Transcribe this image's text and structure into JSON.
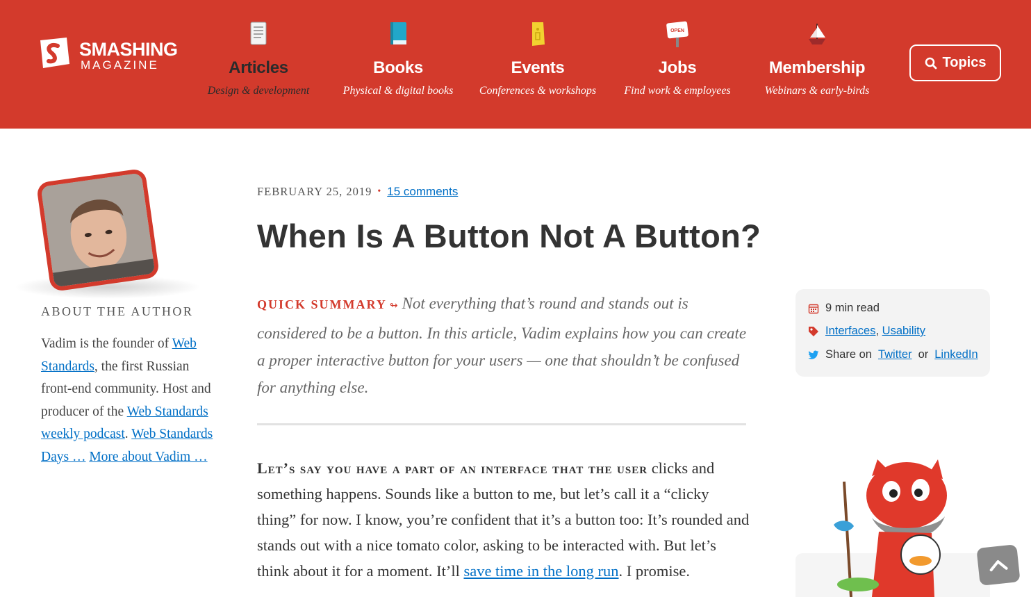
{
  "logo": {
    "title": "SMASHING",
    "subtitle": "MAGAZINE"
  },
  "nav": [
    {
      "title": "Articles",
      "subtitle": "Design & development",
      "icon": "article-icon",
      "active": true
    },
    {
      "title": "Books",
      "subtitle": "Physical & digital books",
      "icon": "book-icon"
    },
    {
      "title": "Events",
      "subtitle": "Conferences & workshops",
      "icon": "ticket-icon"
    },
    {
      "title": "Jobs",
      "subtitle": "Find work & employees",
      "icon": "open-sign-icon",
      "icon_text": "OPEN"
    },
    {
      "title": "Membership",
      "subtitle": "Webinars & early-birds",
      "icon": "ship-icon"
    }
  ],
  "topics": {
    "label": "Topics",
    "icon": "search-icon"
  },
  "author": {
    "about_label": "ABOUT THE AUTHOR",
    "bio_parts": {
      "t1": "Vadim is the founder of ",
      "l1": "Web Standards",
      "t2": ", the first Russian front-end community. Host and producer of the ",
      "l2": "Web Standards weekly podcast",
      "t3": ". ",
      "l3": "Web Standards Days …",
      "t4": " ",
      "l4": "More about Vadim …"
    }
  },
  "article": {
    "date": "FEBRUARY 25, 2019",
    "comments": "15 comments",
    "title": "When Is A Button Not A Button?",
    "summary_label": "QUICK SUMMARY",
    "summary_arrow": "↬",
    "summary": "Not everything that’s round and stands out is considered to be a button. In this article, Vadim explains how you can create a proper interactive button for your users — one that shouldn’t be confused for anything else.",
    "body_lead": "Let’s say you have a part of an interface that the user",
    "body_text": " clicks and something happens. Sounds like a button to me, but let’s call it a “clicky thing” for now. I know, you’re confident that it’s a button too: It’s rounded and stands out with a nice tomato color, asking to be interacted with. But let’s think about it for a moment. It’ll ",
    "body_link": "save time in the long run",
    "body_tail": ". I promise."
  },
  "info": {
    "read_time": "9 min read",
    "tags": [
      "Interfaces",
      "Usability"
    ],
    "tag_sep": ",",
    "share_label": "Share on",
    "share_twitter": "Twitter",
    "share_or": "or",
    "share_linkedin": "LinkedIn"
  },
  "colors": {
    "brand": "#d33a2c",
    "link": "#006fc6",
    "text": "#333333"
  }
}
